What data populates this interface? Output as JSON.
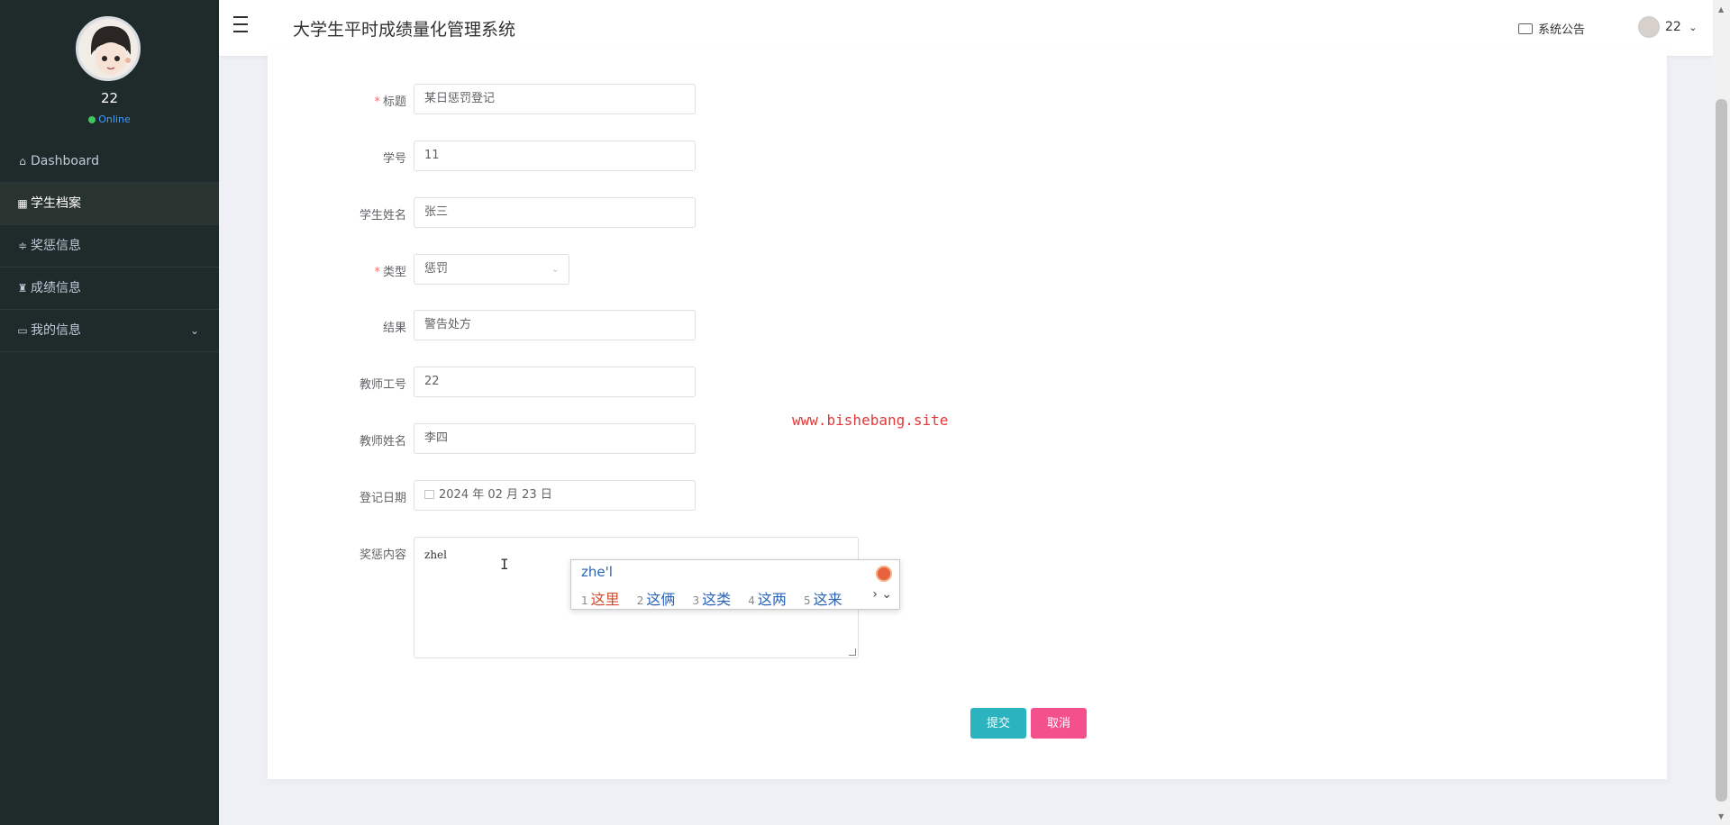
{
  "header": {
    "title": "大学生平时成绩量化管理系统",
    "notice_label": "系统公告",
    "user_label": "22"
  },
  "sidebar": {
    "username": "22",
    "status": "Online",
    "items": [
      {
        "label": "Dashboard",
        "icon": "home-icon"
      },
      {
        "label": "学生档案",
        "icon": "grid-icon"
      },
      {
        "label": "奖惩信息",
        "icon": "sliders-icon"
      },
      {
        "label": "成绩信息",
        "icon": "trophy-icon"
      },
      {
        "label": "我的信息",
        "icon": "card-icon"
      }
    ]
  },
  "form": {
    "fields": [
      {
        "label": "标题",
        "required": true,
        "value": "某日惩罚登记"
      },
      {
        "label": "学号",
        "required": false,
        "value": "11"
      },
      {
        "label": "学生姓名",
        "required": false,
        "value": "张三"
      },
      {
        "label": "类型",
        "required": true,
        "value": "惩罚"
      },
      {
        "label": "结果",
        "required": false,
        "value": "警告处方"
      },
      {
        "label": "教师工号",
        "required": false,
        "value": "22"
      },
      {
        "label": "教师姓名",
        "required": false,
        "value": "李四"
      },
      {
        "label": "登记日期",
        "required": false,
        "value": "2024 年 02 月 23 日"
      },
      {
        "label": "奖惩内容",
        "required": false,
        "value": "zhel"
      }
    ],
    "required_mark": "*",
    "submit_label": "提交",
    "cancel_label": "取消"
  },
  "ime": {
    "composition": "zhe'l",
    "candidates": [
      {
        "num": "1",
        "text": "这里"
      },
      {
        "num": "2",
        "text": "这俩"
      },
      {
        "num": "3",
        "text": "这类"
      },
      {
        "num": "4",
        "text": "这两"
      },
      {
        "num": "5",
        "text": "这来"
      }
    ],
    "more": "› ⌄"
  },
  "watermark": "www.bishebang.site",
  "colors": {
    "sidebar_bg": "#1f2a2a",
    "submit": "#2bb3c0",
    "cancel": "#f3508c",
    "online": "#409eff",
    "watermark": "#e03a3a"
  }
}
